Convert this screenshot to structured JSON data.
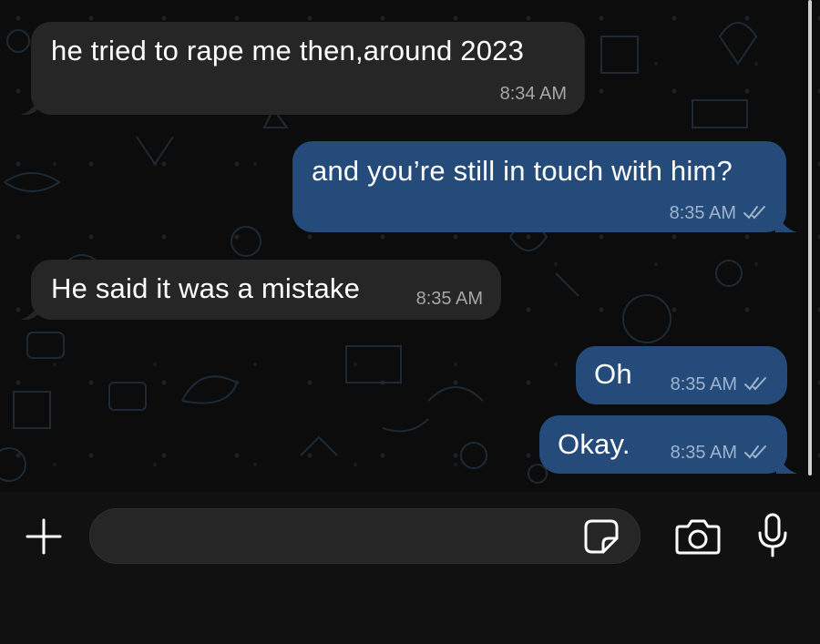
{
  "messages": [
    {
      "direction": "incoming",
      "text": "he tried to rape me then,around 2023",
      "time": "8:34 AM"
    },
    {
      "direction": "outgoing",
      "text": "and you’re still in touch with him?",
      "time": "8:35 AM",
      "status": "read"
    },
    {
      "direction": "incoming",
      "text": "He said it was a mistake",
      "time": "8:35 AM"
    },
    {
      "direction": "outgoing",
      "text": "Oh",
      "time": "8:35 AM",
      "status": "read"
    },
    {
      "direction": "outgoing",
      "text": "Okay.",
      "time": "8:35 AM",
      "status": "read"
    }
  ],
  "composer": {
    "placeholder": "",
    "value": "",
    "icons": [
      "plus-icon",
      "sticker-icon",
      "camera-icon",
      "microphone-icon"
    ]
  },
  "colors": {
    "incoming_bubble": "#262626",
    "outgoing_bubble": "#244b79",
    "background": "#0c0c0c",
    "timestamp": "#a6a6a6"
  }
}
